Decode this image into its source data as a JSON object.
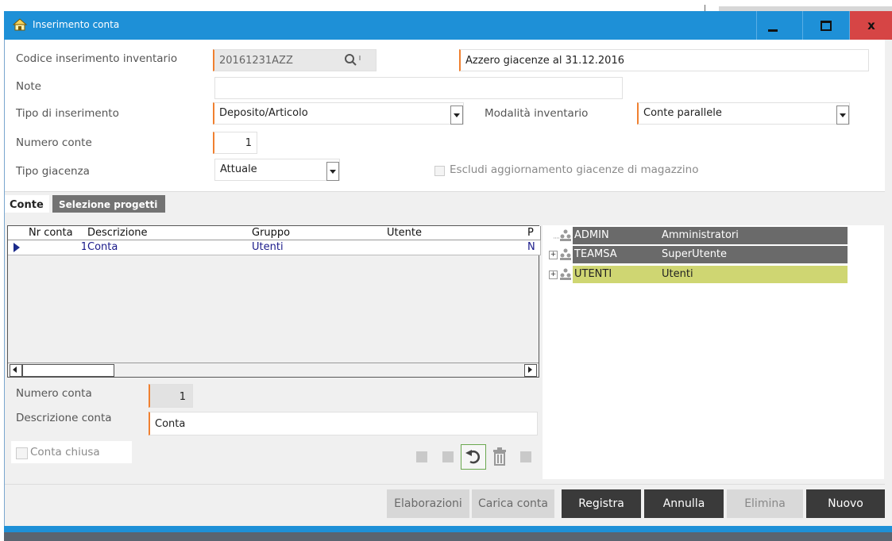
{
  "window": {
    "title": "Inserimento conta",
    "controls": {
      "minimize": "",
      "maximize": "",
      "close": "x"
    }
  },
  "form": {
    "codice_label": "Codice inserimento inventario",
    "codice_value": "20161231AZZ",
    "codice_desc": "Azzero giacenze al 31.12.2016",
    "note_label": "Note",
    "note_value": "",
    "tipo_ins_label": "Tipo di inserimento",
    "tipo_ins_value": "Deposito/Articolo",
    "modalita_label": "Modalità inventario",
    "modalita_value": "Conte parallele",
    "numero_conte_label": "Numero conte",
    "numero_conte_value": "1",
    "tipo_giacenza_label": "Tipo giacenza",
    "tipo_giacenza_value": "Attuale",
    "escludi_label": "Escludi aggiornamento giacenze di magazzino"
  },
  "tabs": [
    {
      "label": "Conte",
      "active": true
    },
    {
      "label": "Selezione progetti",
      "active": false
    }
  ],
  "grid": {
    "columns": [
      "Nr conta",
      "Descrizione",
      "Gruppo",
      "Utente",
      "P"
    ],
    "rows": [
      {
        "nr": "1",
        "descrizione": "Conta",
        "gruppo": "Utenti",
        "utente": "",
        "p": "N"
      }
    ]
  },
  "detail": {
    "numero_conta_label": "Numero conta",
    "numero_conta_value": "1",
    "descrizione_conta_label": "Descrizione conta",
    "descrizione_conta_value": "Conta",
    "conta_chiusa_label": "Conta chiusa"
  },
  "tree": [
    {
      "code": "ADMIN",
      "name": "Amministratori",
      "style": "dark",
      "expandable": false
    },
    {
      "code": "TEAMSA",
      "name": "SuperUtente",
      "style": "dark",
      "expandable": true
    },
    {
      "code": "UTENTI",
      "name": "Utenti",
      "style": "selected",
      "expandable": true
    }
  ],
  "buttons": {
    "elaborazioni": "Elaborazioni",
    "carica_conta": "Carica conta",
    "registra": "Registra",
    "annulla": "Annulla",
    "elimina": "Elimina",
    "nuovo": "Nuovo"
  },
  "colors": {
    "titlebar": "#1e90d7",
    "required_marker": "#f08030",
    "tree_selected": "#cfd672",
    "tree_dark": "#6a6a6a",
    "close_button": "#d64545"
  }
}
